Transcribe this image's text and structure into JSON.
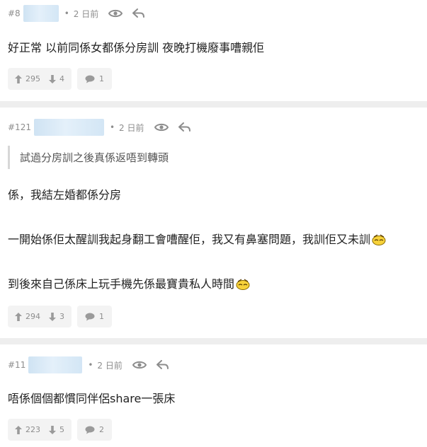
{
  "posts": [
    {
      "floor": "#8",
      "time": "2 日前",
      "quote": "",
      "lines": [
        "好正常 以前同係女都係分房訓 夜晚打機廢事嘈親佢"
      ],
      "upvotes": "295",
      "downvotes": "4",
      "replies": "1"
    },
    {
      "floor": "#121",
      "time": "2 日前",
      "quote": "試過分房訓之後真係返唔到轉頭",
      "lines": [
        "係，我結左婚都係分房",
        "一開始係佢太醒訓我起身翻工會嘈醒佢，我又有鼻塞問題，我訓佢又未訓",
        "到後來自己係床上玩手機先係最寶貴私人時間"
      ],
      "upvotes": "294",
      "downvotes": "3",
      "replies": "1"
    },
    {
      "floor": "#11",
      "time": "2 日前",
      "quote": "",
      "lines": [
        "唔係個個都慣同伴侶share一張床"
      ],
      "upvotes": "223",
      "downvotes": "5",
      "replies": "2"
    }
  ],
  "icons": {
    "view": "eye-icon",
    "reply": "reply-arrow-icon",
    "upvote": "arrow-up-icon",
    "downvote": "arrow-down-icon",
    "comment": "chat-bubble-icon",
    "emoji": "sleepy-face-emoji-icon"
  },
  "colors": {
    "meta_text": "#8d8d8d",
    "body_text": "#222222",
    "button_bg": "#f3f3f3",
    "separator": "#eeeeee",
    "blur_name": "#d3e6f5"
  }
}
